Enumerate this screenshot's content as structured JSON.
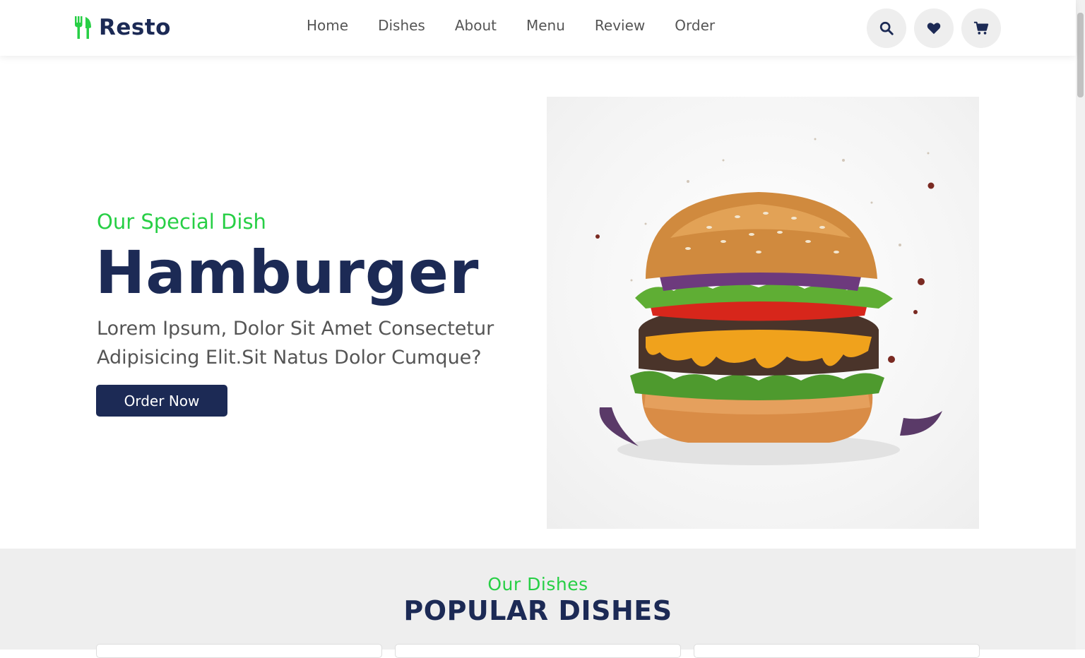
{
  "header": {
    "logo_text": "Resto",
    "nav": [
      "Home",
      "Dishes",
      "About",
      "Menu",
      "Review",
      "Order"
    ],
    "icons": [
      "search-icon",
      "heart-icon",
      "cart-icon"
    ]
  },
  "hero": {
    "subtitle": "Our Special Dish",
    "title": "Hamburger",
    "description": "Lorem Ipsum, Dolor Sit Amet Consectetur Adipisicing Elit.Sit Natus Dolor Cumque?",
    "button": "Order Now"
  },
  "dishes": {
    "subtitle": "Our Dishes",
    "title": "POPULAR DISHES"
  },
  "colors": {
    "accent": "#27cf45",
    "primary": "#1c2a55",
    "section_bg": "#eeeeee"
  }
}
